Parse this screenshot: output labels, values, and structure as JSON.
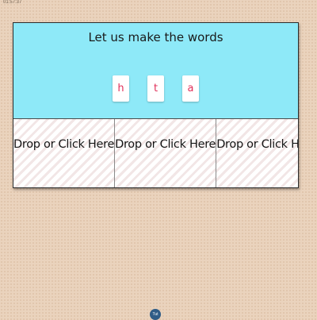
{
  "timer": "01:57:37",
  "activity": {
    "title": "Let us make the words",
    "tiles": [
      "h",
      "t",
      "a"
    ],
    "drop_slots": [
      "Drop or Click Here",
      "Drop or Click Here",
      "Drop or Click Here"
    ]
  },
  "bottom_icon": {
    "label": "Tut"
  },
  "colors": {
    "page_background": "#ead3bd",
    "prompt_background": "#8ee9f8",
    "tile_text": "#e0305a",
    "icon_background": "#2f5c86"
  }
}
